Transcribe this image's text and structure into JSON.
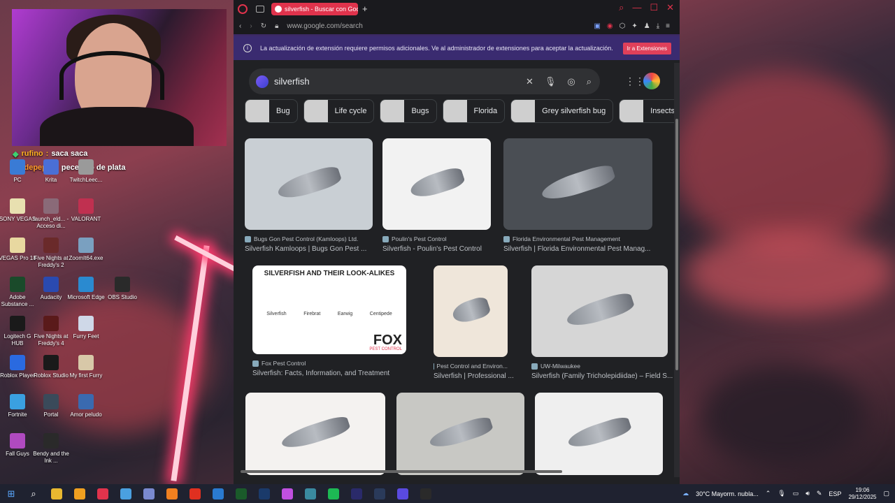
{
  "chat": [
    {
      "user": "rufino",
      "text": "saca saca"
    },
    {
      "user": "fandepepsi",
      "text": "pececillo de plata"
    }
  ],
  "desktop_icons": [
    {
      "label": "PC",
      "color": "#3a7bd5"
    },
    {
      "label": "Krita",
      "color": "#4a6fd6"
    },
    {
      "label": "TwitchLeec...",
      "color": "#9a9a9a"
    },
    {
      "label": "SONY VEGAS",
      "color": "#e8e0b0"
    },
    {
      "label": "launch_eld... - Acceso di...",
      "color": "#8a6a78"
    },
    {
      "label": "VALORANT",
      "color": "#c03050"
    },
    {
      "label": "VEGAS Pro 18",
      "color": "#e8d8a0"
    },
    {
      "label": "Five Nights at Freddy's 2",
      "color": "#6a2a2a"
    },
    {
      "label": "ZoomIt64.exe",
      "color": "#7aa0c0"
    },
    {
      "label": "Adobe Substance ...",
      "color": "#1a4a2a"
    },
    {
      "label": "Audacity",
      "color": "#2a4ab0"
    },
    {
      "label": "Microsoft Edge",
      "color": "#2a8ad0"
    },
    {
      "label": "OBS Studio",
      "color": "#2a2a2a"
    },
    {
      "label": "Logitech G HUB",
      "color": "#1a1a1a"
    },
    {
      "label": "Five Nights at Freddy's 4",
      "color": "#5a1a1a"
    },
    {
      "label": "Furry Feet",
      "color": "#cfd8e8"
    },
    {
      "label": "Roblox Player",
      "color": "#2a6ae0"
    },
    {
      "label": "Roblox Studio",
      "color": "#1a1a1a"
    },
    {
      "label": "My first Furry",
      "color": "#d8c8a8"
    },
    {
      "label": "Fortnite",
      "color": "#3aa0e0"
    },
    {
      "label": "Portal",
      "color": "#3a4a5a"
    },
    {
      "label": "Amor peludo",
      "color": "#3a6ab0"
    },
    {
      "label": "Fall Guys",
      "color": "#b04ac0"
    },
    {
      "label": "Bendy and the Ink ...",
      "color": "#2a2a2a"
    }
  ],
  "browser": {
    "tab_title": "silverfish - Buscar con Goo",
    "url": "www.google.com/search",
    "info_message": "La actualización de extensión requiere permisos adicionales. Ve al administrador de extensiones para aceptar la actualización.",
    "info_button": "Ir a Extensiones",
    "search_query": "silverfish",
    "chips": [
      "Bug",
      "Life cycle",
      "Bugs",
      "Florida",
      "Grey silverfish bug",
      "Insects"
    ],
    "results": [
      {
        "source": "Bugs Gon Pest Control (Kamloops) Ltd.",
        "title": "Silverfish Kamloops | Bugs Gon Pest ...",
        "color": "#c9cfd4"
      },
      {
        "source": "Poulin's Pest Control",
        "title": "Silverfish - Poulin's Pest Control",
        "color": "#f2f2f2"
      },
      {
        "source": "Florida Environmental Pest Management",
        "title": "Silverfish | Florida Environmental Pest Manag...",
        "color": "#4a4e54"
      },
      {
        "source": "Fox Pest Control",
        "title": "Silverfish: Facts, Information, and Treatment",
        "color": "#ffffff"
      },
      {
        "source": "Pest Control and Environ...",
        "title": "Silverfish | Professional ...",
        "color": "#efe6da"
      },
      {
        "source": "UW-Milwaukee",
        "title": "Silverfish (Family Tricholepidiidae) – Field S...",
        "color": "#d6d6d6"
      },
      {
        "source": "",
        "title": "",
        "color": "#f4f2f0"
      },
      {
        "source": "",
        "title": "",
        "color": "#c8c8c4"
      },
      {
        "source": "",
        "title": "",
        "color": "#efefef"
      }
    ],
    "fox_heading": "SILVERFISH AND THEIR LOOK-ALIKES",
    "fox_labels": [
      "Silverfish",
      "Firebrat",
      "Earwig",
      "Centipede"
    ],
    "fox_brand": "FOX",
    "fox_sub": "PEST CONTROL"
  },
  "taskbar": {
    "weather": "30°C  Mayorm. nubla...",
    "lang": "ESP",
    "time": "19:06",
    "date": "29/12/2025",
    "apps": [
      "#e8b830",
      "#f0a020",
      "#e0334c",
      "#4aa0e0",
      "#7a8ad0",
      "#f08020",
      "#e03020",
      "#2a7ad0",
      "#1a5a2a",
      "#1a3a6a",
      "#c050e0",
      "#3a8aa0",
      "#1db954",
      "#2a2a6a",
      "#2a3a5a",
      "#5a4ae0",
      "#2a2a2a"
    ]
  }
}
